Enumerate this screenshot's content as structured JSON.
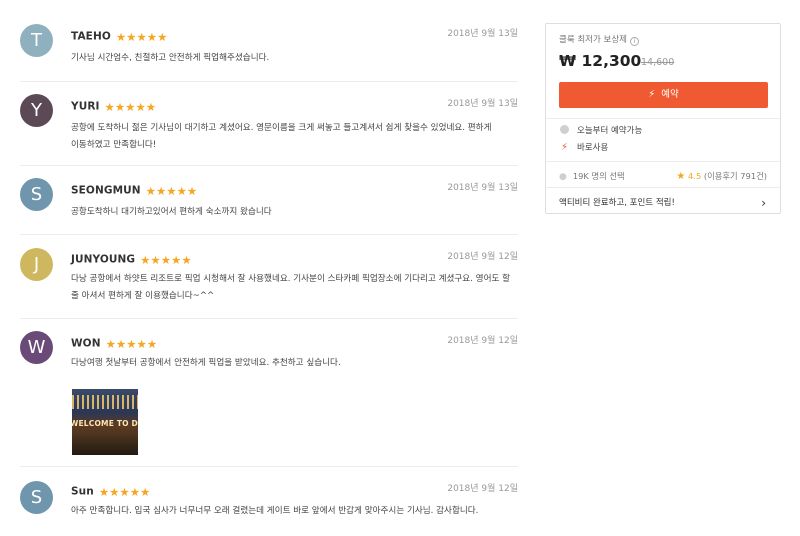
{
  "reviews": [
    {
      "initial": "T",
      "color": "#8fb0bf",
      "name": "TAEHO",
      "stars": "★★★★★",
      "date": "2018년 9월 13일",
      "text": "기사님 시간엄수, 친절하고 안전하게 픽업해주셨습니다."
    },
    {
      "initial": "Y",
      "color": "#5b4a56",
      "name": "YURI",
      "stars": "★★★★★",
      "date": "2018년 9월 13일",
      "text": "공항에 도착하니 젊은 기사님이 대기하고 계셨어요. 영문이름을 크게 써놓고 들고계셔서 쉽게 찾을수 있었네요. 편하게 이동하였고 만족합니다!"
    },
    {
      "initial": "S",
      "color": "#6f96ad",
      "name": "SEONGMUN",
      "stars": "★★★★★",
      "date": "2018년 9월 13일",
      "text": "공항도착하니 대기하고있어서 편하게 숙소까지 왔습니다"
    },
    {
      "initial": "J",
      "color": "#cfb75f",
      "name": "JUNYOUNG",
      "stars": "★★★★★",
      "date": "2018년 9월 12일",
      "text": "다낭 공항에서 하얏트 리조트로 픽업 시청해서 잘 사용했네요. 기사분이 스타카페 픽업장소에 기다리고 계셨구요. 영어도 할 줄 아셔서 편하게 잘 이용했습니다~^^"
    },
    {
      "initial": "W",
      "color": "#6a4b78",
      "name": "WON",
      "stars": "★★★★★",
      "date": "2018년 9월 12일",
      "text": "다낭여행 첫날부터 공항에서 안전하게 픽업을 받았네요. 추천하고 싶습니다.",
      "photo_caption": "WELCOME TO DANANG"
    },
    {
      "initial": "S",
      "color": "#6f96ad",
      "name": "Sun",
      "stars": "★★★★★",
      "date": "2018년 9월 12일",
      "text": "아주 만족합니다. 입국 심사가 너무너무 오래 걸렸는데 게이트 바로 앞에서 반갑게 맞아주시는 기사님. 감사합니다."
    }
  ],
  "panel": {
    "label": "클룩 최저가 보상제",
    "info_glyph": "i",
    "price": "₩ 12,300",
    "original_price": "14,600",
    "book_label": "예약",
    "book_icon": "⚡",
    "features": [
      {
        "icon": "clock-icon",
        "label": "오늘부터 예약가능"
      },
      {
        "icon": "bolt-icon",
        "label": "바로사용"
      }
    ],
    "booked_count": "19K 명의 선택",
    "rating_score": "4.5",
    "rating_reviews": "(이용후기 791건)",
    "promo": "액티비티 완료하고, 포인트 적립!",
    "accent_color": "#f05a32",
    "star_color": "#f5a623"
  }
}
